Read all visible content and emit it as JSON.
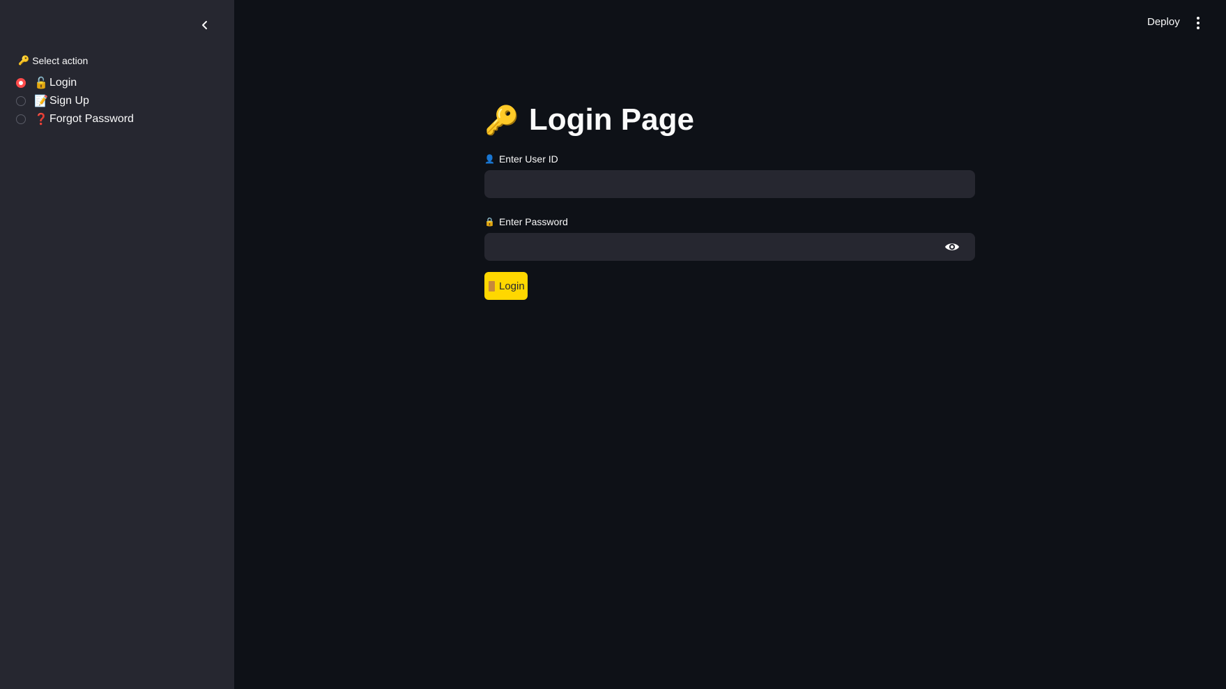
{
  "sidebar": {
    "radio_label": "Select action",
    "radio_label_icon": "key-icon",
    "options": [
      {
        "label": "Login",
        "icon": "unlocked-lock-icon",
        "glyph": "🔓",
        "selected": true
      },
      {
        "label": "Sign Up",
        "icon": "memo-icon",
        "glyph": "📝",
        "selected": false
      },
      {
        "label": "Forgot Password",
        "icon": "question-mark-icon",
        "glyph": "❓",
        "selected": false
      }
    ],
    "collapse_icon": "chevron-left-icon"
  },
  "header": {
    "deploy_label": "Deploy",
    "menu_icon": "more-vertical-icon"
  },
  "main": {
    "title": "Login Page",
    "title_icon": "key-icon",
    "title_glyph": "🔑",
    "user_id_label": "Enter User ID",
    "user_id_label_glyph": "👤",
    "user_id_value": "",
    "password_label": "Enter Password",
    "password_label_glyph": "🔒",
    "password_value": "",
    "password_toggle_icon": "eye-icon",
    "login_button_label": "Login",
    "login_button_icon": "door-icon"
  },
  "colors": {
    "background": "#0e1117",
    "sidebar": "#262730",
    "input": "#262730",
    "accent_radio": "#ff4b4b",
    "login_button": "#ffd700"
  }
}
